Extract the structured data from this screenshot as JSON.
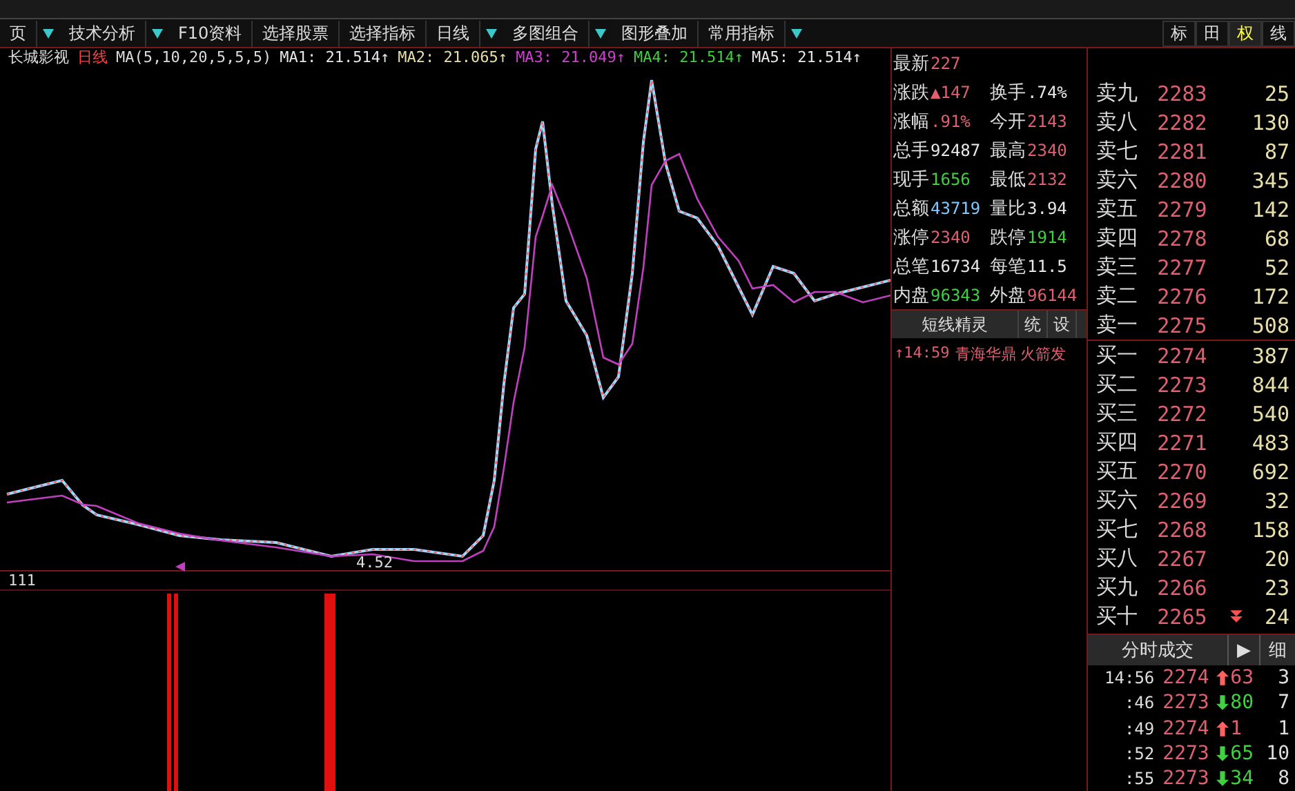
{
  "toolbar": {
    "items": [
      {
        "label": "页",
        "dropdown": true
      },
      {
        "label": "技术分析",
        "dropdown": true
      },
      {
        "label": "F10资料",
        "dropdown": false
      },
      {
        "label": "选择股票",
        "dropdown": false
      },
      {
        "label": "选择指标",
        "dropdown": false
      },
      {
        "label": "日线",
        "dropdown": true
      },
      {
        "label": "多图组合",
        "dropdown": true
      },
      {
        "label": "图形叠加",
        "dropdown": false
      },
      {
        "label": "常用指标",
        "dropdown": true
      }
    ],
    "right_tabs": [
      {
        "label": "标",
        "selected": false
      },
      {
        "label": "田",
        "selected": false
      },
      {
        "label": "权",
        "selected": true
      },
      {
        "label": "线",
        "selected": false
      }
    ]
  },
  "chart": {
    "stock": "长城影视",
    "period": "日线",
    "ma_params": "MA(5,10,20,5,5,5)",
    "ma": [
      {
        "label": "MA1: 21.514↑",
        "color": "#e8e8e8"
      },
      {
        "label": "MA2: 21.065↑",
        "color": "#e8e0a8"
      },
      {
        "label": "MA3: 21.049↑",
        "color": "#d040d0"
      },
      {
        "label": "MA4: 21.514↑",
        "color": "#40d040"
      },
      {
        "label": "MA5: 21.514↑",
        "color": "#e8e8e8"
      }
    ],
    "low_label": "4.52",
    "indicator_label": "111"
  },
  "quote": {
    "rows": [
      {
        "cells": [
          {
            "label": "最新",
            "value": "227",
            "color": "#e06070"
          }
        ]
      },
      {
        "cells": [
          {
            "label": "涨跌",
            "value": "▲147",
            "color": "#e06070"
          },
          {
            "label": "换手",
            "value": ".74%",
            "color": "#e8e8e8"
          }
        ]
      },
      {
        "cells": [
          {
            "label": "涨幅",
            "value": ".91%",
            "color": "#e06070"
          },
          {
            "label": "今开",
            "value": "2143",
            "color": "#e06070"
          }
        ]
      },
      {
        "cells": [
          {
            "label": "总手",
            "value": "92487",
            "color": "#e8e8e8"
          },
          {
            "label": "最高",
            "value": "2340",
            "color": "#e06070"
          }
        ]
      },
      {
        "cells": [
          {
            "label": "现手",
            "value": "1656",
            "color": "#40d040"
          },
          {
            "label": "最低",
            "value": "2132",
            "color": "#e06070"
          }
        ]
      },
      {
        "cells": [
          {
            "label": "总额",
            "value": "43719",
            "color": "#80c8ff"
          },
          {
            "label": "量比",
            "value": "3.94",
            "color": "#e8e8e8"
          }
        ]
      },
      {
        "cells": [
          {
            "label": "涨停",
            "value": "2340",
            "color": "#e06070"
          },
          {
            "label": "跌停",
            "value": "1914",
            "color": "#40d040"
          }
        ]
      },
      {
        "cells": [
          {
            "label": "总笔",
            "value": "16734",
            "color": "#e8e8e8"
          },
          {
            "label": "每笔",
            "value": "11.5",
            "color": "#e8e8e8"
          }
        ]
      },
      {
        "cells": [
          {
            "label": "内盘",
            "value": "96343",
            "color": "#40d040"
          },
          {
            "label": "外盘",
            "value": "96144",
            "color": "#e06070"
          }
        ]
      }
    ],
    "buttons": [
      "短线精灵",
      "统",
      "设"
    ],
    "news": {
      "time": "↑14:59",
      "text": "青海华鼎 火箭发"
    }
  },
  "order_book": {
    "sell": [
      {
        "label": "卖九",
        "price": "2283",
        "volume": "25"
      },
      {
        "label": "卖八",
        "price": "2282",
        "volume": "130"
      },
      {
        "label": "卖七",
        "price": "2281",
        "volume": "87"
      },
      {
        "label": "卖六",
        "price": "2280",
        "volume": "345"
      },
      {
        "label": "卖五",
        "price": "2279",
        "volume": "142"
      },
      {
        "label": "卖四",
        "price": "2278",
        "volume": "68"
      },
      {
        "label": "卖三",
        "price": "2277",
        "volume": "52"
      },
      {
        "label": "卖二",
        "price": "2276",
        "volume": "172"
      },
      {
        "label": "卖一",
        "price": "2275",
        "volume": "508"
      }
    ],
    "buy": [
      {
        "label": "买一",
        "price": "2274",
        "volume": "387"
      },
      {
        "label": "买二",
        "price": "2273",
        "volume": "844"
      },
      {
        "label": "买三",
        "price": "2272",
        "volume": "540"
      },
      {
        "label": "买四",
        "price": "2271",
        "volume": "483"
      },
      {
        "label": "买五",
        "price": "2270",
        "volume": "692"
      },
      {
        "label": "买六",
        "price": "2269",
        "volume": "32"
      },
      {
        "label": "买七",
        "price": "2268",
        "volume": "158"
      },
      {
        "label": "买八",
        "price": "2267",
        "volume": "20"
      },
      {
        "label": "买九",
        "price": "2266",
        "volume": "23"
      },
      {
        "label": "买十",
        "price": "2265",
        "volume": "24",
        "more": true
      }
    ]
  },
  "trades": {
    "title": "分时成交",
    "next": "▶",
    "detail": "细",
    "rows": [
      {
        "time": "14:56",
        "price": "2274",
        "kind": "up",
        "vol": "63",
        "count": "3"
      },
      {
        "time": ":46",
        "price": "2273",
        "kind": "down",
        "vol": "80",
        "count": "7"
      },
      {
        "time": ":49",
        "price": "2274",
        "kind": "up",
        "vol": "1",
        "count": "1"
      },
      {
        "time": ":52",
        "price": "2273",
        "kind": "down",
        "vol": "65",
        "count": "10"
      },
      {
        "time": ":55",
        "price": "2273",
        "kind": "down",
        "vol": "34",
        "count": "8"
      }
    ]
  }
}
